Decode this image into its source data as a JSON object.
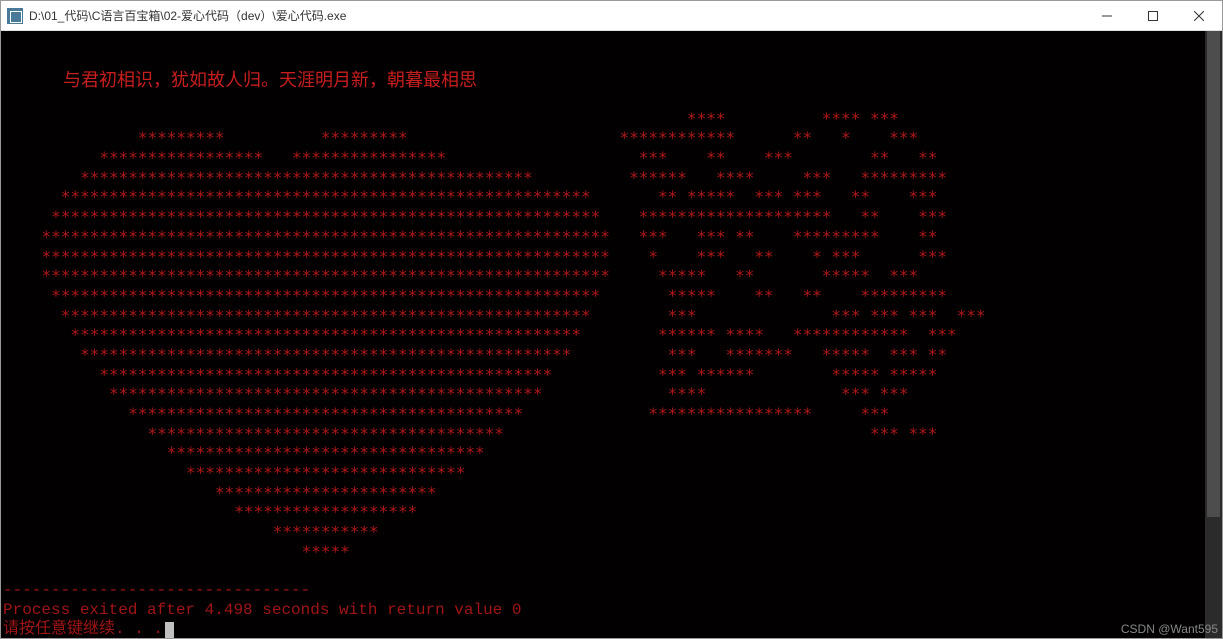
{
  "window": {
    "title": "D:\\01_代码\\C语言百宝箱\\02-爱心代码（dev）\\爱心代码.exe"
  },
  "colors": {
    "console_bg": "#020000",
    "text_red": "#b01818",
    "message_red": "#c81e1e"
  },
  "message": "与君初相识，犹如故人归。天涯明月新，朝暮最相思",
  "art_lines": [
    "                                                                       ****          **** ***",
    "              *********          *********                      ************      **   *    ***",
    "          *****************   ****************                    ***    **    ***        **   **",
    "        ***********************************************          ******   ****     ***   *********",
    "      *******************************************************       ** *****  *** ***   **    ***",
    "     *********************************************************    ********************   **    ***",
    "    ***********************************************************   ***   *** **    *********    **",
    "    ***********************************************************    *    ***   **    * ***      ***",
    "    ***********************************************************     *****   **       *****  ***",
    "     *********************************************************       *****    **   **    *********",
    "      *******************************************************        ***              *** *** ***  ***",
    "       *****************************************************        ****** ****   ************  ***",
    "        ***************************************************          ***   *******   *****  *** **",
    "          ***********************************************           *** ******        ***** *****",
    "           *********************************************             ****              *** ***",
    "             *****************************************             *****************     ***",
    "               *************************************                                      *** ***",
    "                 *********************************",
    "                   *****************************",
    "                      ***********************",
    "                        *******************",
    "                            ***********",
    "                               *****"
  ],
  "divider": "--------------------------------",
  "exit_message": "Process exited after 4.498 seconds with return value 0",
  "continue_message": "请按任意键继续. . .",
  "watermark": "CSDN @Want595"
}
